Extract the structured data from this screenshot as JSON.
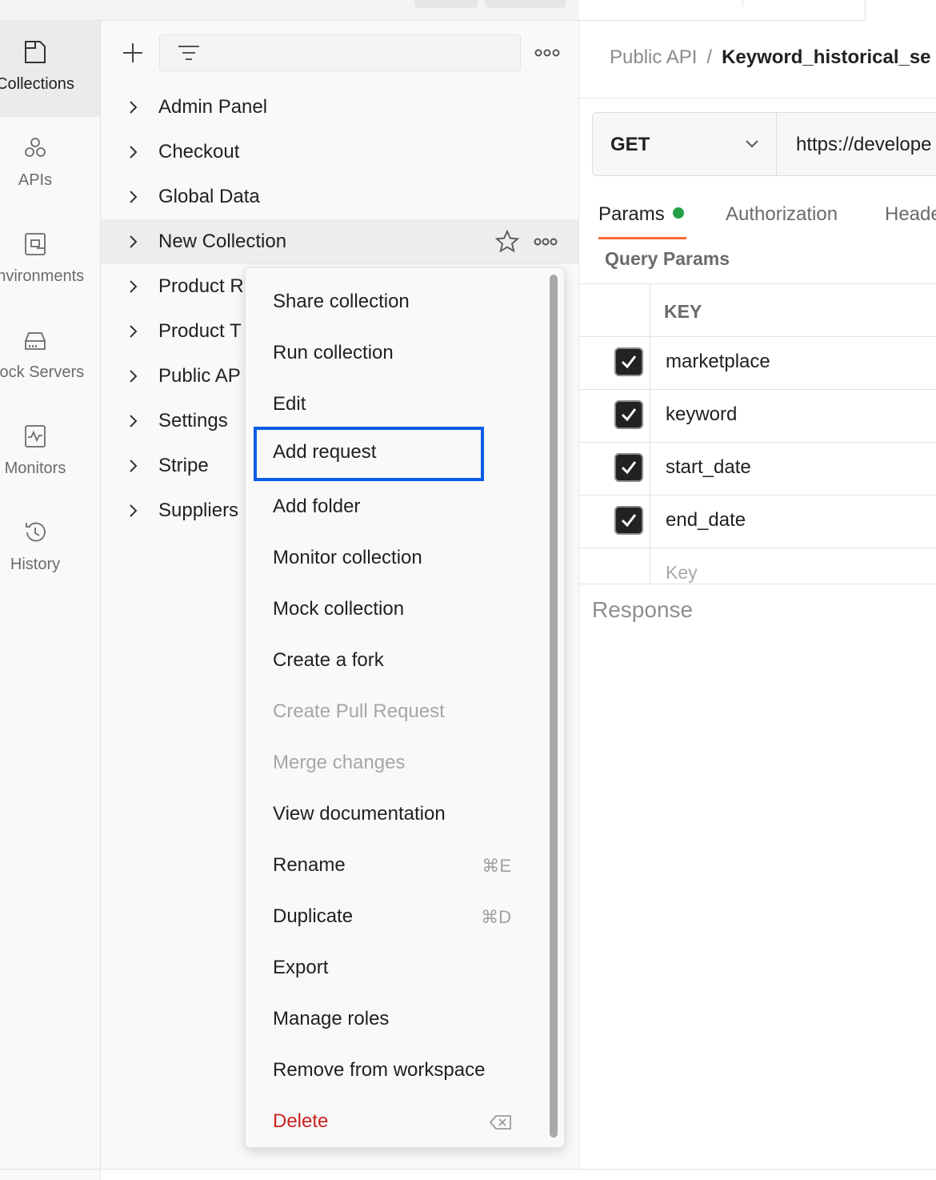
{
  "rail": {
    "items": [
      {
        "label": "Collections",
        "icon": "collections-icon"
      },
      {
        "label": "APIs",
        "icon": "apis-icon"
      },
      {
        "label": "Environments",
        "icon": "environments-icon"
      },
      {
        "label": "Mock Servers",
        "icon": "mock-servers-icon"
      },
      {
        "label": "Monitors",
        "icon": "monitors-icon"
      },
      {
        "label": "History",
        "icon": "history-icon"
      }
    ]
  },
  "panel": {
    "search_placeholder": "",
    "collections": [
      {
        "name": "Admin Panel"
      },
      {
        "name": "Checkout"
      },
      {
        "name": "Global Data"
      },
      {
        "name": "New Collection"
      },
      {
        "name": "Product R"
      },
      {
        "name": "Product T"
      },
      {
        "name": "Public AP"
      },
      {
        "name": "Settings"
      },
      {
        "name": "Stripe"
      },
      {
        "name": "Suppliers"
      }
    ]
  },
  "context_menu": {
    "items": [
      {
        "label": "Share collection",
        "state": "normal",
        "shortcut": ""
      },
      {
        "label": "Run collection",
        "state": "normal",
        "shortcut": ""
      },
      {
        "label": "Edit",
        "state": "normal",
        "shortcut": ""
      },
      {
        "label": "Add request",
        "state": "focused",
        "shortcut": ""
      },
      {
        "label": "Add folder",
        "state": "normal",
        "shortcut": ""
      },
      {
        "label": "Monitor collection",
        "state": "normal",
        "shortcut": ""
      },
      {
        "label": "Mock collection",
        "state": "normal",
        "shortcut": ""
      },
      {
        "label": "Create a fork",
        "state": "normal",
        "shortcut": ""
      },
      {
        "label": "Create Pull Request",
        "state": "disabled",
        "shortcut": ""
      },
      {
        "label": "Merge changes",
        "state": "disabled",
        "shortcut": ""
      },
      {
        "label": "View documentation",
        "state": "normal",
        "shortcut": ""
      },
      {
        "label": "Rename",
        "state": "normal",
        "shortcut": "⌘E"
      },
      {
        "label": "Duplicate",
        "state": "normal",
        "shortcut": "⌘D"
      },
      {
        "label": "Export",
        "state": "normal",
        "shortcut": ""
      },
      {
        "label": "Manage roles",
        "state": "normal",
        "shortcut": ""
      },
      {
        "label": "Remove from workspace",
        "state": "normal",
        "shortcut": ""
      },
      {
        "label": "Delete",
        "state": "danger",
        "shortcut": "backspace-icon"
      }
    ]
  },
  "request": {
    "breadcrumb": {
      "parent": "Public API",
      "separator": "/",
      "current": "Keyword_historical_se"
    },
    "method": "GET",
    "url": "https://develope",
    "tabs": [
      {
        "label": "Params",
        "active": true,
        "dot": true
      },
      {
        "label": "Authorization",
        "active": false
      },
      {
        "label": "Heade",
        "active": false
      }
    ],
    "query_params_title": "Query Params",
    "key_header": "KEY",
    "params": [
      {
        "key": "marketplace",
        "checked": true
      },
      {
        "key": "keyword",
        "checked": true
      },
      {
        "key": "start_date",
        "checked": true
      },
      {
        "key": "end_date",
        "checked": true
      }
    ],
    "key_placeholder": "Key",
    "response_label": "Response"
  },
  "colors": {
    "accent_tab": "#ff6c37",
    "focus_ring": "#0a5de8",
    "danger": "#c8211d",
    "params_dot": "#24a148"
  }
}
